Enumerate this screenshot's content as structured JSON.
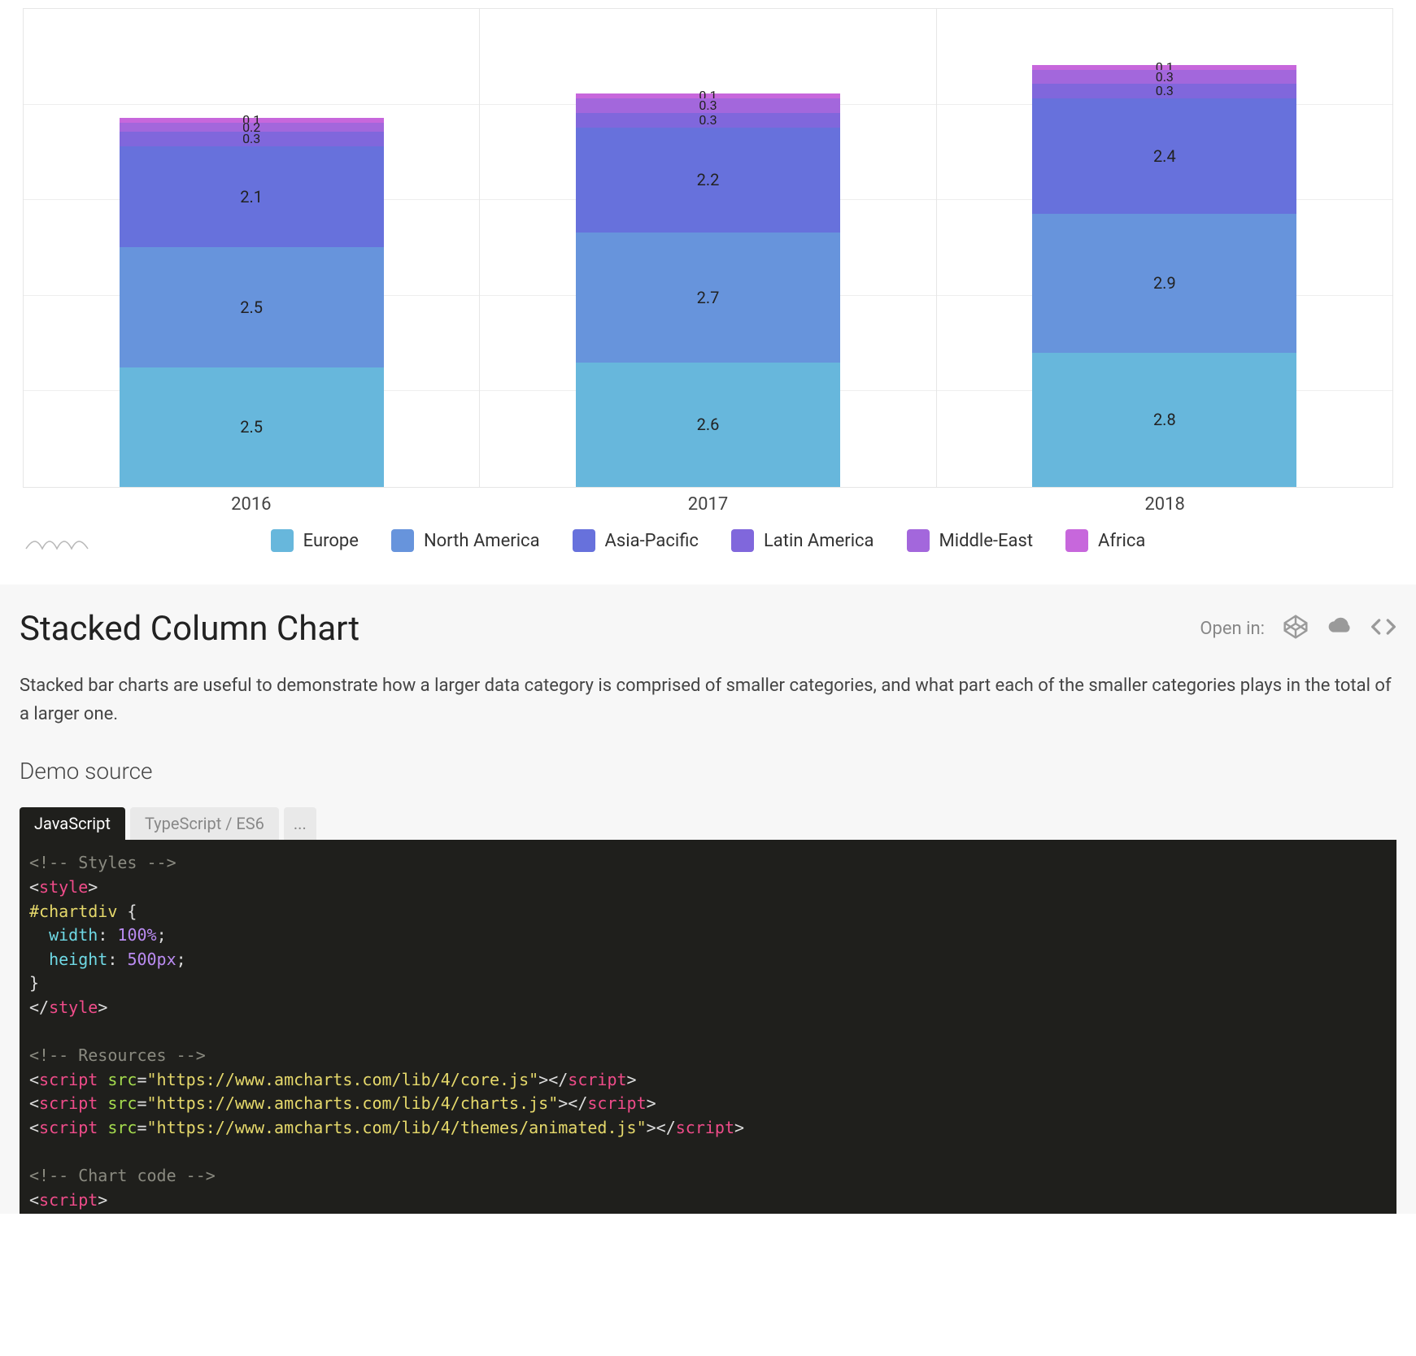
{
  "chart_data": {
    "type": "bar",
    "stacked": true,
    "categories": [
      "2016",
      "2017",
      "2018"
    ],
    "series": [
      {
        "name": "Europe",
        "color": "#67b7dc",
        "values": [
          2.5,
          2.6,
          2.8
        ]
      },
      {
        "name": "North America",
        "color": "#6794dc",
        "values": [
          2.5,
          2.7,
          2.9
        ]
      },
      {
        "name": "Asia-Pacific",
        "color": "#6771dc",
        "values": [
          2.1,
          2.2,
          2.4
        ]
      },
      {
        "name": "Latin America",
        "color": "#8067dc",
        "values": [
          0.3,
          0.3,
          0.3
        ]
      },
      {
        "name": "Middle-East",
        "color": "#a367dc",
        "values": [
          0.2,
          0.3,
          0.3
        ]
      },
      {
        "name": "Africa",
        "color": "#c767dc",
        "values": [
          0.1,
          0.1,
          0.1
        ]
      }
    ],
    "ylim": [
      0,
      10
    ],
    "grid_spacing": 2
  },
  "legend_items": [
    "Europe",
    "North America",
    "Asia-Pacific",
    "Latin America",
    "Middle-East",
    "Africa"
  ],
  "docs": {
    "title": "Stacked Column Chart",
    "open_in_label": "Open in:",
    "description": "Stacked bar charts are useful to demonstrate how a larger data category is comprised of smaller categories, and what part each of the smaller categories plays in the total of a larger one.",
    "demo_source_label": "Demo source",
    "tabs": {
      "js": "JavaScript",
      "ts": "TypeScript / ES6",
      "more": "..."
    },
    "code_urls": {
      "core": "https://www.amcharts.com/lib/4/core.js",
      "charts": "https://www.amcharts.com/lib/4/charts.js",
      "anim": "https://www.amcharts.com/lib/4/themes/animated.js"
    }
  }
}
